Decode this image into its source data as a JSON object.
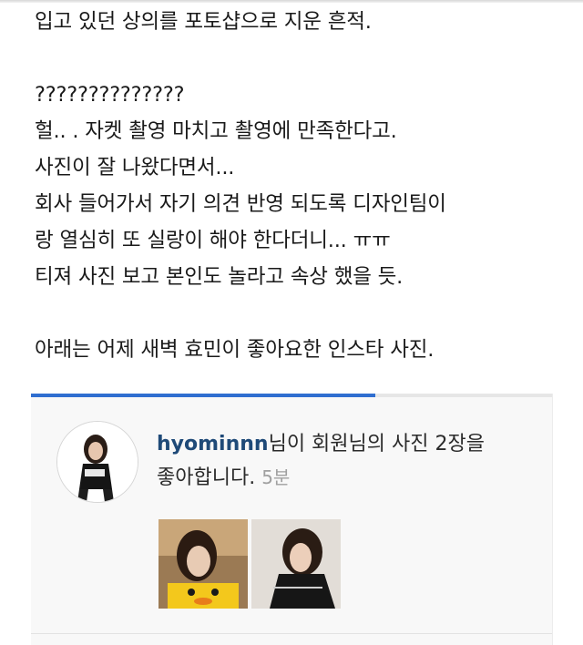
{
  "post": {
    "lines": [
      "입고 있던 상의를 포토샵으로 지운 흔적.",
      "",
      "??????????????",
      "헐.. . 자켓 촬영 마치고 촬영에 만족한다고.",
      "사진이 잘 나왔다면서...",
      "회사 들어가서 자기 의견 반영 되도록 디자인팀이",
      "랑 열심히 또 실랑이 해야 한다더니... ㅠㅠ",
      "티져 사진 보고 본인도 놀라고 속상 했을 듯.",
      "",
      "아래는 어제 새벽 효민이 좋아요한 인스타 사진."
    ]
  },
  "notification": {
    "username": "hyominnn",
    "message_part1": "님이 회원님의 사진 2장을",
    "message_part2": "좋아합니다.",
    "time": "5분",
    "progress_fraction": 0.66,
    "accent_color": "#2f6ed0"
  }
}
